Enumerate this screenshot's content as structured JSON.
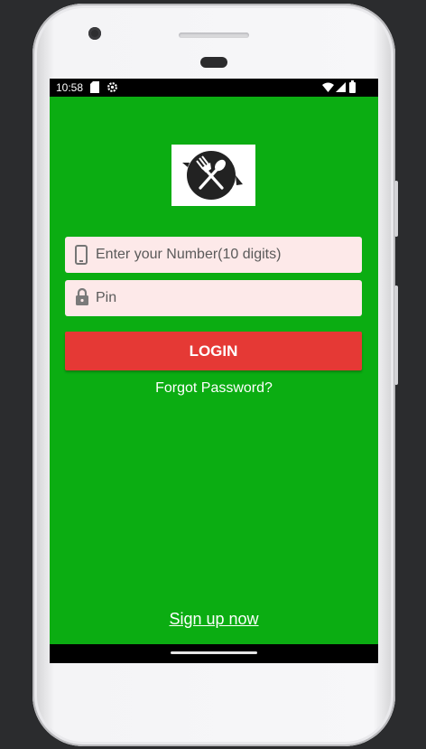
{
  "status_bar": {
    "time": "10:58",
    "icons": [
      "sd-card-icon",
      "settings-icon",
      "wifi-icon",
      "signal-icon",
      "battery-icon"
    ]
  },
  "logo": {
    "icon": "fork-spoon-icon",
    "background": "#ffffff",
    "circle_color": "#222222"
  },
  "form": {
    "phone_placeholder": "Enter your Number(10 digits)",
    "phone_icon": "phone-icon",
    "pin_placeholder": "Pin",
    "pin_icon": "lock-icon",
    "login_label": "LOGIN",
    "forgot_label": "Forgot Password?"
  },
  "footer": {
    "signup_label": "Sign up now"
  },
  "colors": {
    "screen_background": "#0bad12",
    "login_button": "#e53935",
    "field_background": "#fde9e9"
  }
}
